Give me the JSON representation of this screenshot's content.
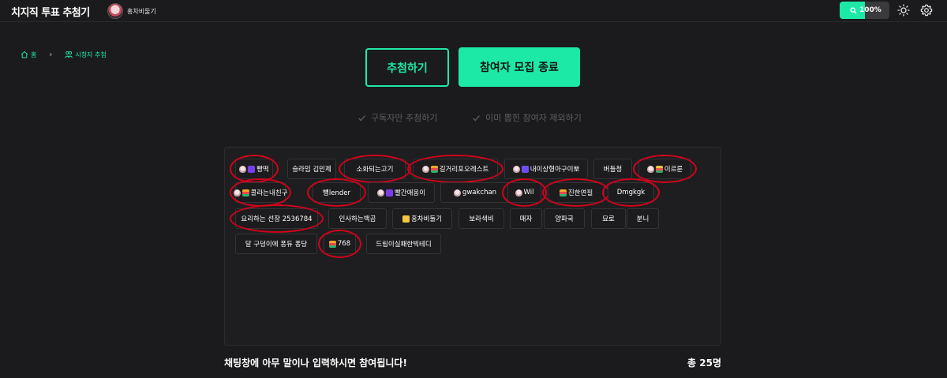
{
  "app": {
    "title": "치지직 투표 추첨기"
  },
  "channel": {
    "name": "홍차비둘기"
  },
  "zoom": {
    "label": "100%",
    "level": 0.5
  },
  "breadcrumb": {
    "home": "홈",
    "current": "시청자 추첨"
  },
  "buttons": {
    "draw": "추첨하기",
    "end_recruit": "참여자 모집 종료"
  },
  "options": {
    "subscribers_only": "구독자만 추첨하기",
    "exclude_drawn": "이미 뽑힌 참여자 제외하기"
  },
  "participants": [
    {
      "name": "빵떡",
      "badges": [
        "egg",
        "heart"
      ],
      "circled": true
    },
    {
      "name": "슬라임 김민제",
      "badges": [],
      "circled": false
    },
    {
      "name": "소화되는고기",
      "badges": [],
      "circled": true
    },
    {
      "name": "길거리포오레스트",
      "badges": [
        "egg",
        "rainbow"
      ],
      "circled": true
    },
    {
      "name": "내이상형아구이뽀",
      "badges": [
        "egg",
        "tag"
      ],
      "circled": false
    },
    {
      "name": "버들청",
      "badges": [],
      "circled": false
    },
    {
      "name": "이르룬",
      "badges": [
        "egg",
        "rainbow2"
      ],
      "circled": true
    },
    {
      "name": "콜라는내친구",
      "badges": [
        "egg",
        "rainbow"
      ],
      "circled": true
    },
    {
      "name": "뻉lender",
      "badges": [],
      "circled": true
    },
    {
      "name": "빨간애옹이",
      "badges": [
        "egg",
        "heart"
      ],
      "circled": false
    },
    {
      "name": "gwakchan",
      "badges": [
        "egg"
      ],
      "circled": false
    },
    {
      "name": "Wil",
      "badges": [
        "egg"
      ],
      "circled": true
    },
    {
      "name": "진한연필",
      "badges": [
        "rainbow"
      ],
      "circled": true
    },
    {
      "name": "Dmgkgk",
      "badges": [],
      "circled": true
    },
    {
      "name": "요리하는 선장 2536784",
      "badges": [],
      "circled": true
    },
    {
      "name": "인사하는백곰",
      "badges": [],
      "circled": false
    },
    {
      "name": "홍차비둘기",
      "badges": [
        "coin"
      ],
      "circled": false
    },
    {
      "name": "보라색비",
      "badges": [],
      "circled": false
    },
    {
      "name": "매자",
      "badges": [],
      "circled": false
    },
    {
      "name": "양파국",
      "badges": [],
      "circled": false
    },
    {
      "name": "묘로",
      "badges": [],
      "circled": false
    },
    {
      "name": "분니",
      "badges": [],
      "circled": false
    },
    {
      "name": "달 구덩이에 퐁듀 퐁당",
      "badges": [],
      "circled": false
    },
    {
      "name": "768",
      "badges": [
        "rainbow"
      ],
      "circled": true
    },
    {
      "name": "드림이실패한빅테디",
      "badges": [],
      "circled": false
    }
  ],
  "footer": {
    "instruction": "채팅창에 아무 말이나 입력하시면 참여됩니다!",
    "total": "총 25명"
  },
  "colors": {
    "accent": "#1de9a6",
    "background": "#1b1b1d",
    "annotation": "#d0021b"
  }
}
